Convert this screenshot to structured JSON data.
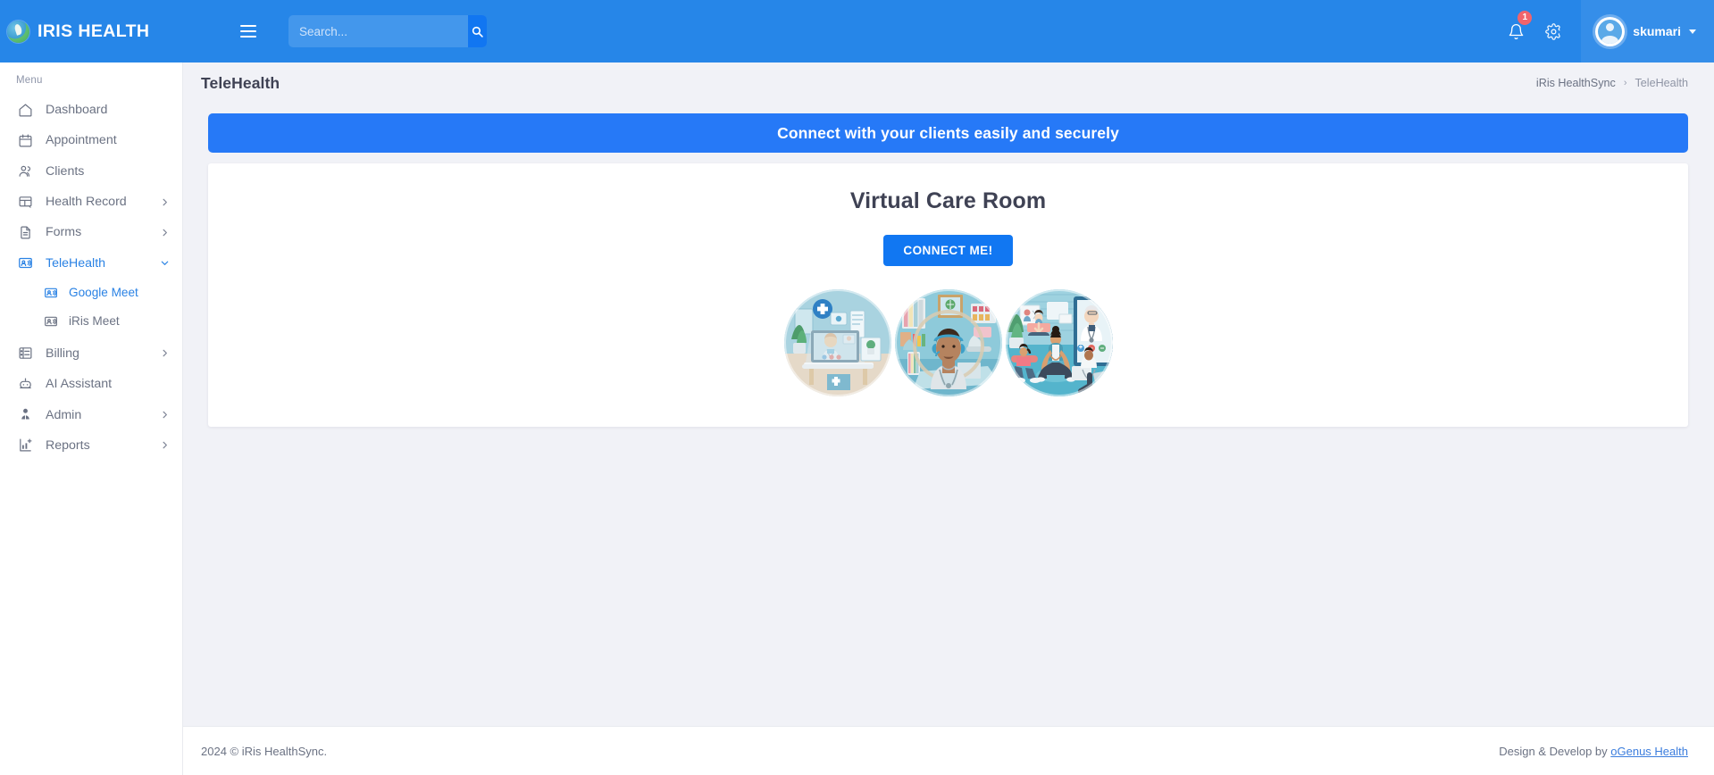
{
  "header": {
    "brand": "IRIS HEALTH",
    "logo_icon": "globe-leaf-logo-icon",
    "menu_toggle_icon": "hamburger-icon",
    "search": {
      "value": "",
      "placeholder": "Search...",
      "button_icon": "search-icon"
    },
    "notifications": {
      "icon": "bell-icon",
      "count": "1"
    },
    "settings": {
      "icon": "gear-icon"
    },
    "user": {
      "name": "skumari",
      "avatar_icon": "user-avatar-icon",
      "caret_icon": "chevron-down-icon"
    }
  },
  "sidebar": {
    "section_label": "Menu",
    "items": [
      {
        "label": "Dashboard",
        "icon": "home-icon",
        "has_chevron": false,
        "active": false
      },
      {
        "label": "Appointment",
        "icon": "calendar-icon",
        "has_chevron": false,
        "active": false
      },
      {
        "label": "Clients",
        "icon": "users-icon",
        "has_chevron": false,
        "active": false
      },
      {
        "label": "Health Record",
        "icon": "grid-heart-icon",
        "has_chevron": true,
        "active": false
      },
      {
        "label": "Forms",
        "icon": "document-icon",
        "has_chevron": true,
        "active": false
      },
      {
        "label": "TeleHealth",
        "icon": "id-card-icon",
        "has_chevron": true,
        "active": true
      },
      {
        "label": "Billing",
        "icon": "billing-list-icon",
        "has_chevron": true,
        "active": false
      },
      {
        "label": "AI Assistant",
        "icon": "robot-icon",
        "has_chevron": false,
        "active": false
      },
      {
        "label": "Admin",
        "icon": "admin-user-icon",
        "has_chevron": true,
        "active": false
      },
      {
        "label": "Reports",
        "icon": "chart-plus-icon",
        "has_chevron": true,
        "active": false
      }
    ],
    "telehealth_children": [
      {
        "label": "Google Meet",
        "icon": "id-card-icon",
        "active": true
      },
      {
        "label": "iRis Meet",
        "icon": "id-card-icon",
        "active": false
      }
    ]
  },
  "page": {
    "title": "TeleHealth",
    "breadcrumb": {
      "root": "iRis HealthSync",
      "separator": "›",
      "current": "TeleHealth"
    },
    "banner_text": "Connect with your clients easily and securely",
    "card": {
      "heading": "Virtual Care Room",
      "connect_button": "CONNECT ME!",
      "images": [
        {
          "alt": "telehealth-laptop-consultation-illustration"
        },
        {
          "alt": "doctor-with-headset-illustration"
        },
        {
          "alt": "group-telehealth-wellness-session-illustration"
        }
      ]
    }
  },
  "footer": {
    "copyright": "2024 © iRis HealthSync.",
    "credit_prefix": "Design & Develop by ",
    "credit_link": "oGenus Health"
  },
  "colors": {
    "header_blue": "#2686e8",
    "banner_blue": "#2679f7",
    "button_blue": "#1177f2",
    "accent_blue": "#2a82e4",
    "badge_red": "#f1646c",
    "page_bg": "#f1f2f7"
  }
}
